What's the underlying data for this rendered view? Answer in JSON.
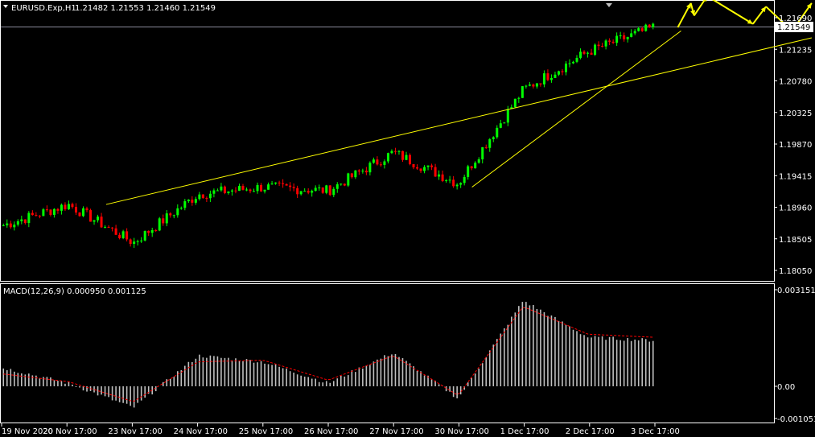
{
  "header": {
    "symbol": "EURUSD.Exp,H1",
    "ohlc": "1.21482 1.21553 1.21460 1.21549"
  },
  "price_axis": {
    "ticks": [
      "1.21690",
      "1.21235",
      "1.20780",
      "1.20325",
      "1.19870",
      "1.19415",
      "1.18960",
      "1.18505",
      "1.18050"
    ],
    "current_price": "1.21549"
  },
  "macd": {
    "label": "MACD(12,26,9) 0.000950 0.001125",
    "ticks": [
      "0.003151",
      "0.00",
      "-0.001051"
    ]
  },
  "time_axis": {
    "labels": [
      "19 Nov 2020",
      "20 Nov 17:00",
      "23 Nov 17:00",
      "24 Nov 17:00",
      "25 Nov 17:00",
      "26 Nov 17:00",
      "27 Nov 17:00",
      "30 Nov 17:00",
      "1 Dec 17:00",
      "2 Dec 17:00",
      "3 Dec 17:00"
    ]
  },
  "colors": {
    "background": "#000000",
    "bull": "#00ff00",
    "bear": "#ff0000",
    "trendline": "#ffff00",
    "forecast_arrow": "#ffff00",
    "macd_histogram": "#c0c0c0",
    "signal_line": "#ff0000",
    "grid_frame": "#ffffff"
  },
  "chart_data": [
    {
      "type": "candlestick",
      "x": [
        "19 Nov 2020",
        "20 Nov 17:00",
        "23 Nov 17:00",
        "24 Nov 17:00",
        "25 Nov 17:00",
        "26 Nov 17:00",
        "27 Nov 17:00",
        "30 Nov 17:00",
        "1 Dec 17:00",
        "2 Dec 17:00",
        "3 Dec 17:00"
      ],
      "close": [
        1.187,
        1.19,
        1.1845,
        1.1915,
        1.1925,
        1.192,
        1.1975,
        1.193,
        1.2065,
        1.212,
        1.2155
      ],
      "ylim": [
        1.178,
        1.219
      ]
    },
    {
      "type": "bar",
      "x": [
        "19 Nov 2020",
        "20 Nov 17:00",
        "23 Nov 17:00",
        "24 Nov 17:00",
        "25 Nov 17:00",
        "26 Nov 17:00",
        "27 Nov 17:00",
        "30 Nov 17:00",
        "1 Dec 17:00",
        "2 Dec 17:00",
        "3 Dec 17:00"
      ],
      "series": [
        {
          "name": "MACD",
          "values": [
            0.0006,
            0.0001,
            -0.0007,
            0.001,
            0.0008,
            0.0001,
            0.0011,
            -0.0004,
            0.0028,
            0.0016,
            0.0015
          ]
        },
        {
          "name": "Signal",
          "values": [
            0.0004,
            0.00015,
            -0.0005,
            0.0008,
            0.00085,
            0.0002,
            0.001,
            -0.0003,
            0.0026,
            0.0017,
            0.0016
          ]
        }
      ],
      "ylim": [
        -0.001051,
        0.003151
      ]
    }
  ]
}
